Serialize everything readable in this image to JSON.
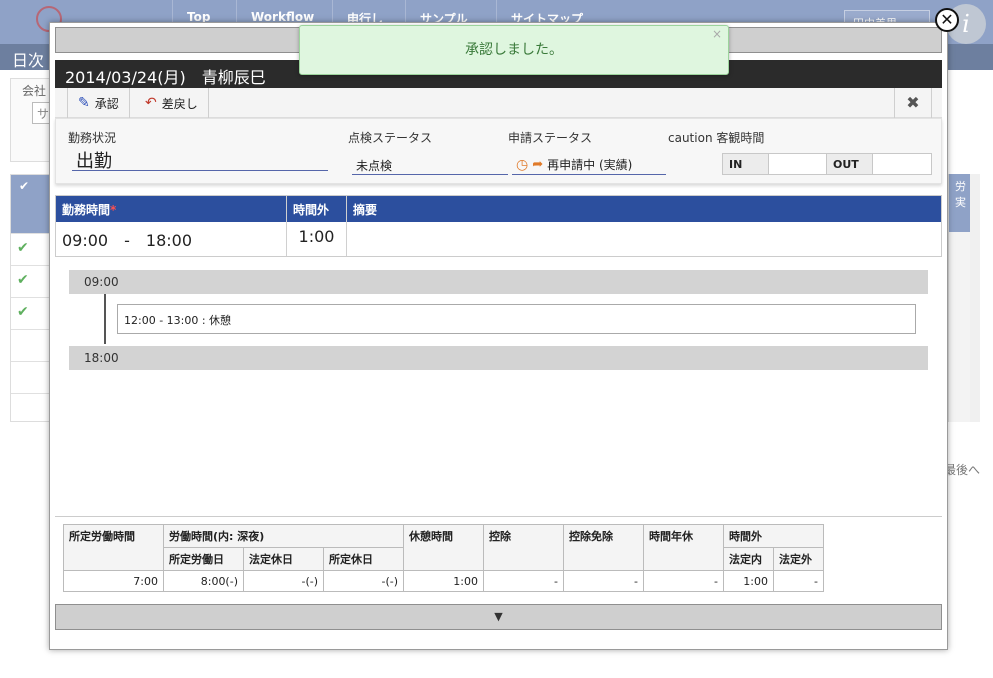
{
  "background": {
    "nav": [
      "Top",
      "Workflow",
      "申行し",
      "サンプル",
      "サイトマップ"
    ],
    "user_button": "田中美里",
    "brand_glyph": "i",
    "page_title": "日次",
    "company_label": "会社",
    "select_text": "サ",
    "table_right_head": "労 実",
    "last_link": "最後へ"
  },
  "toast": {
    "message": "承認しました。",
    "close": "×"
  },
  "dialog": {
    "header_title": "2014/03/24(月)　青柳辰巳",
    "toolbar": {
      "approve": "承認",
      "send_back": "差戻し",
      "close": "✖"
    },
    "status": {
      "work_status_label": "勤務状況",
      "work_status_value": "出勤",
      "check_status_label": "点検ステータス",
      "check_status_value": "未点検",
      "request_status_label": "申請ステータス",
      "request_status_value": "再申請中 (実績)",
      "caution_label": "caution 客観時間",
      "in_label": "IN",
      "out_label": "OUT"
    },
    "work_table": {
      "headers": {
        "time": "勤務時間",
        "required": "*",
        "overtime": "時間外",
        "note": "摘要"
      },
      "time_value": "09:00　-　18:00",
      "overtime_value": "1:00",
      "note_value": ""
    },
    "timeline": {
      "start": "09:00",
      "block": "12:00 - 13:00 : 休憩",
      "end": "18:00"
    },
    "summary": {
      "h1": "所定労働時間",
      "h2": "労働時間(内: 深夜)",
      "h2a": "所定労働日",
      "h2b": "法定休日",
      "h2c": "所定休日",
      "h3": "休憩時間",
      "h4": "控除",
      "h5": "控除免除",
      "h6": "時間年休",
      "h7": "時間外",
      "h7a": "法定内",
      "h7b": "法定外",
      "values": [
        "7:00",
        "8:00(-)",
        "-(-)",
        "-(-)",
        "1:00",
        "-",
        "-",
        "-",
        "1:00",
        "-"
      ]
    },
    "expand_arrow": "▼"
  },
  "window_close": "✕"
}
